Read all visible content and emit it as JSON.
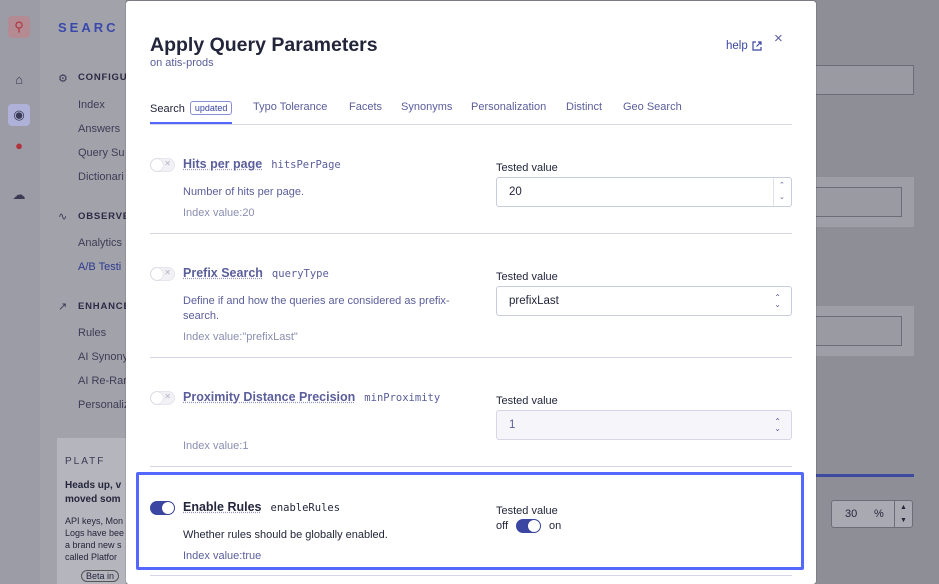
{
  "background": {
    "brand": "SEARC",
    "sidebar": {
      "configure_heading": "CONFIGUR",
      "configure_items": [
        "Index",
        "Answers",
        "Query Su",
        "Dictionari"
      ],
      "observe_heading": "OBSERVE",
      "observe_items": [
        "Analytics",
        "A/B Testi"
      ],
      "enhance_heading": "ENHANCE",
      "enhance_items": [
        "Rules",
        "AI Synony",
        "AI Re-Ran",
        "Personaliz"
      ]
    },
    "platform_card": {
      "heading": "PLATF",
      "line1": "Heads up, v",
      "line2": "moved som",
      "body1": "API keys, Mon",
      "body2": "Logs have bee",
      "body3": "a brand new s",
      "body4": "called Platfor",
      "beta": "Beta in"
    },
    "right_stepper": {
      "value": "30",
      "unit": "%"
    }
  },
  "modal": {
    "title": "Apply Query Parameters",
    "subtitle": "on atis-prods",
    "help_label": "help",
    "close_label": "×",
    "tabs": [
      {
        "label": "Search",
        "badge": "updated",
        "active": true
      },
      {
        "label": "Typo Tolerance"
      },
      {
        "label": "Facets"
      },
      {
        "label": "Synonyms"
      },
      {
        "label": "Personalization"
      },
      {
        "label": "Distinct"
      },
      {
        "label": "Geo Search"
      }
    ],
    "params": [
      {
        "name": "Hits per page",
        "key": "hitsPerPage",
        "description": "Number of hits per page.",
        "index_value": "Index value:20",
        "tested_label": "Tested value",
        "tested_value": "20",
        "enabled": false
      },
      {
        "name": "Prefix Search",
        "key": "queryType",
        "description": "Define if and how the queries are considered as prefix-search.",
        "index_value": "Index value:\"prefixLast\"",
        "tested_label": "Tested value",
        "tested_value": "prefixLast",
        "enabled": false
      },
      {
        "name": "Proximity Distance Precision",
        "key": "minProximity",
        "description": "",
        "index_value": "Index value:1",
        "tested_label": "Tested value",
        "tested_value": "1",
        "enabled": false
      },
      {
        "name": "Enable Rules",
        "key": "enableRules",
        "description": "Whether rules should be globally enabled.",
        "index_value": "Index value:true",
        "tested_label": "Tested value",
        "off_label": "off",
        "on_label": "on",
        "enabled": true
      }
    ]
  },
  "colors": {
    "accent": "#5468ff",
    "primary": "#3a46a1",
    "text": "#23263b",
    "muted": "#5a5e9a"
  }
}
